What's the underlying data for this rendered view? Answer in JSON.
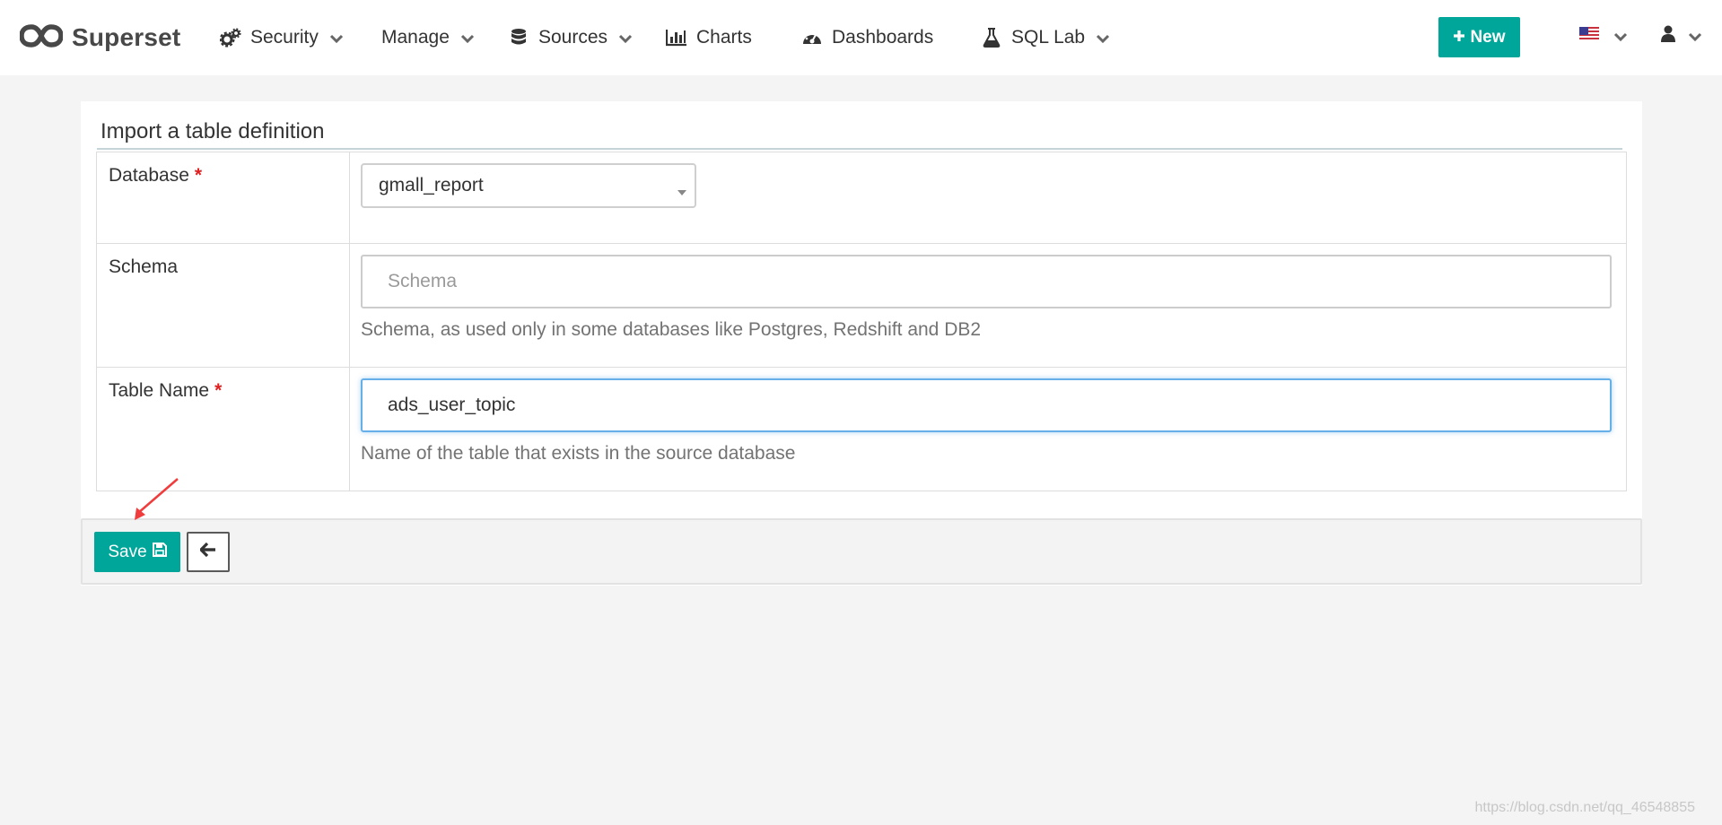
{
  "navbar": {
    "brand": "Superset",
    "items": [
      {
        "label": "Security",
        "icon": "gears-icon",
        "dropdown": true
      },
      {
        "label": "Manage",
        "icon": "",
        "dropdown": true
      },
      {
        "label": "Sources",
        "icon": "database-icon",
        "dropdown": true
      },
      {
        "label": "Charts",
        "icon": "bar-chart-icon",
        "dropdown": false
      },
      {
        "label": "Dashboards",
        "icon": "dashboard-icon",
        "dropdown": false
      },
      {
        "label": "SQL Lab",
        "icon": "flask-icon",
        "dropdown": true
      }
    ],
    "new_button": "New",
    "language_icon": "us-flag-icon",
    "user_icon": "user-icon"
  },
  "form": {
    "title": "Import a table definition",
    "fields": [
      {
        "label": "Database",
        "required": true,
        "type": "select",
        "value": "gmall_report",
        "help": ""
      },
      {
        "label": "Schema",
        "required": false,
        "type": "text",
        "value": "",
        "placeholder": "Schema",
        "help": "Schema, as used only in some databases like Postgres, Redshift and DB2"
      },
      {
        "label": "Table Name",
        "required": true,
        "type": "text",
        "value": "ads_user_topic",
        "placeholder": "",
        "help": "Name of the table that exists in the source database"
      }
    ],
    "required_marker": "*"
  },
  "footer": {
    "save_label": "Save",
    "save_icon": "floppy-disk-icon",
    "back_icon": "arrow-left-icon"
  },
  "watermark": "https://blog.csdn.net/qq_46548855",
  "colors": {
    "accent": "#00a699",
    "required": "#e02020",
    "focus": "#66afe9",
    "annotation": "#f03c3c"
  }
}
